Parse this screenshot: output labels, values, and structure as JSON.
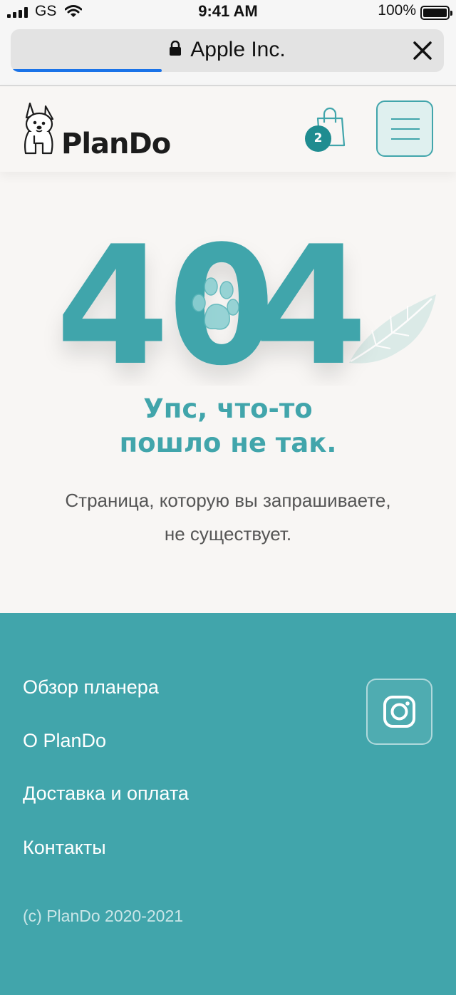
{
  "status_bar": {
    "carrier": "GS",
    "time": "9:41 AM",
    "battery": "100%"
  },
  "browser": {
    "url_title": "Apple Inc."
  },
  "header": {
    "logo_text": "PlanDo",
    "cart_count": "2"
  },
  "error": {
    "code": "404",
    "heading_line1": "Упс, что-то",
    "heading_line2": "пошло не так.",
    "description_line1": "Страница, которую вы запрашиваете,",
    "description_line2": "не существует."
  },
  "footer": {
    "links": [
      {
        "label": "Обзор планера"
      },
      {
        "label": "O PlanDo"
      },
      {
        "label": "Доставка и оплата"
      },
      {
        "label": "Контакты"
      }
    ],
    "copyright": "(c) PlanDo 2020-2021"
  },
  "colors": {
    "brand": "#41a5ab",
    "badge": "#1f8c90",
    "page_bg": "#f8f6f4"
  }
}
